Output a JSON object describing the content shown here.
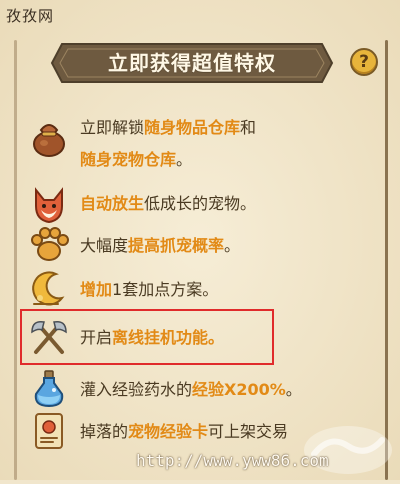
{
  "site_mark": "孜孜网",
  "banner": {
    "title": "立即获得超值特权"
  },
  "help": {
    "label": "?"
  },
  "perks": [
    {
      "icon": "pouch-icon",
      "line1": {
        "a": "立即解锁",
        "b": "随身物品仓库",
        "c": "和"
      },
      "line2": {
        "a": "随身宠物仓库",
        "b": "。"
      }
    },
    {
      "icon": "fox-pet-icon",
      "parts": {
        "a": "自动放生",
        "b": "低成长的宠物。"
      }
    },
    {
      "icon": "paw-icon",
      "parts": {
        "a": "大幅度",
        "b": "提高抓宠概率",
        "c": "。"
      }
    },
    {
      "icon": "moon-icon",
      "parts": {
        "a": "增加",
        "b": "1套加点方案。"
      }
    },
    {
      "icon": "crossed-axes-icon",
      "parts": {
        "a": "开启",
        "b": "离线挂机功能。"
      }
    },
    {
      "icon": "potion-icon",
      "parts": {
        "a": "灌入经验药水的",
        "b": "经验X200%",
        "c": "。"
      }
    },
    {
      "icon": "scroll-card-icon",
      "parts": {
        "a": "掉落的",
        "b": "宠物经验卡",
        "c": "可上架交易"
      }
    }
  ],
  "footer": {
    "url": "http://www.yww86.com"
  },
  "colors": {
    "highlight": "#e28a16",
    "banner": "#6e5a40",
    "box": "#e02b2b"
  }
}
